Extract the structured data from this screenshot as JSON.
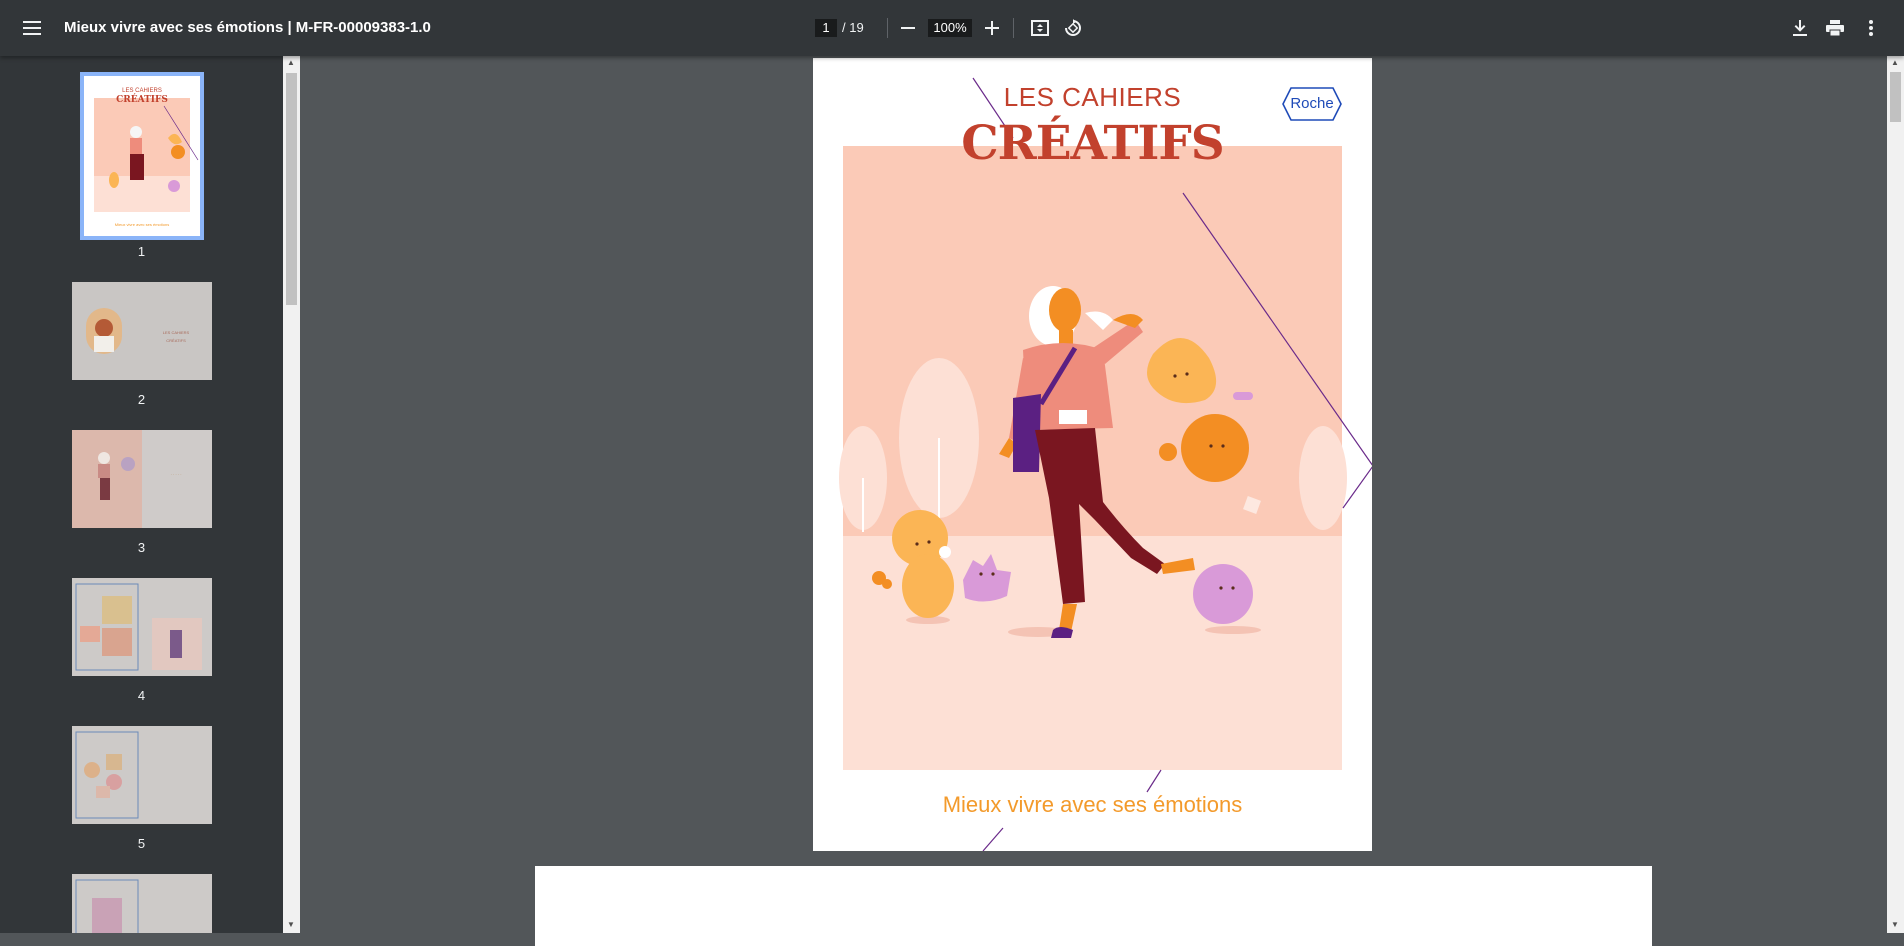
{
  "toolbar": {
    "menu_icon": "hamburger-menu-icon",
    "title": "Mieux vivre avec ses émotions | M-FR-00009383-1.0",
    "current_page": "1",
    "total_pages": "/ 19",
    "zoom": "100%",
    "icons": [
      "zoom-out-icon",
      "zoom-in-icon",
      "fit-page-icon",
      "rotate-icon",
      "download-icon",
      "print-icon",
      "more-vert-icon"
    ]
  },
  "sidebar": {
    "thumbnails": [
      {
        "number": "1",
        "selected": true
      },
      {
        "number": "2",
        "selected": false
      },
      {
        "number": "3",
        "selected": false
      },
      {
        "number": "4",
        "selected": false
      },
      {
        "number": "5",
        "selected": false
      }
    ]
  },
  "document": {
    "cover": {
      "line1": "LES CAHIERS",
      "line2": "CRÉATIFS",
      "brand": "Roche",
      "subtitle": "Mieux vivre avec ses émotions"
    }
  },
  "colors": {
    "toolbar": "#323639",
    "viewer_bg": "#525659",
    "cover_red": "#c2412d",
    "cover_orange": "#f39a2b",
    "cover_peach": "#fbcab7",
    "roche_blue": "#1f4bb8",
    "selection": "#8ab4f8"
  }
}
